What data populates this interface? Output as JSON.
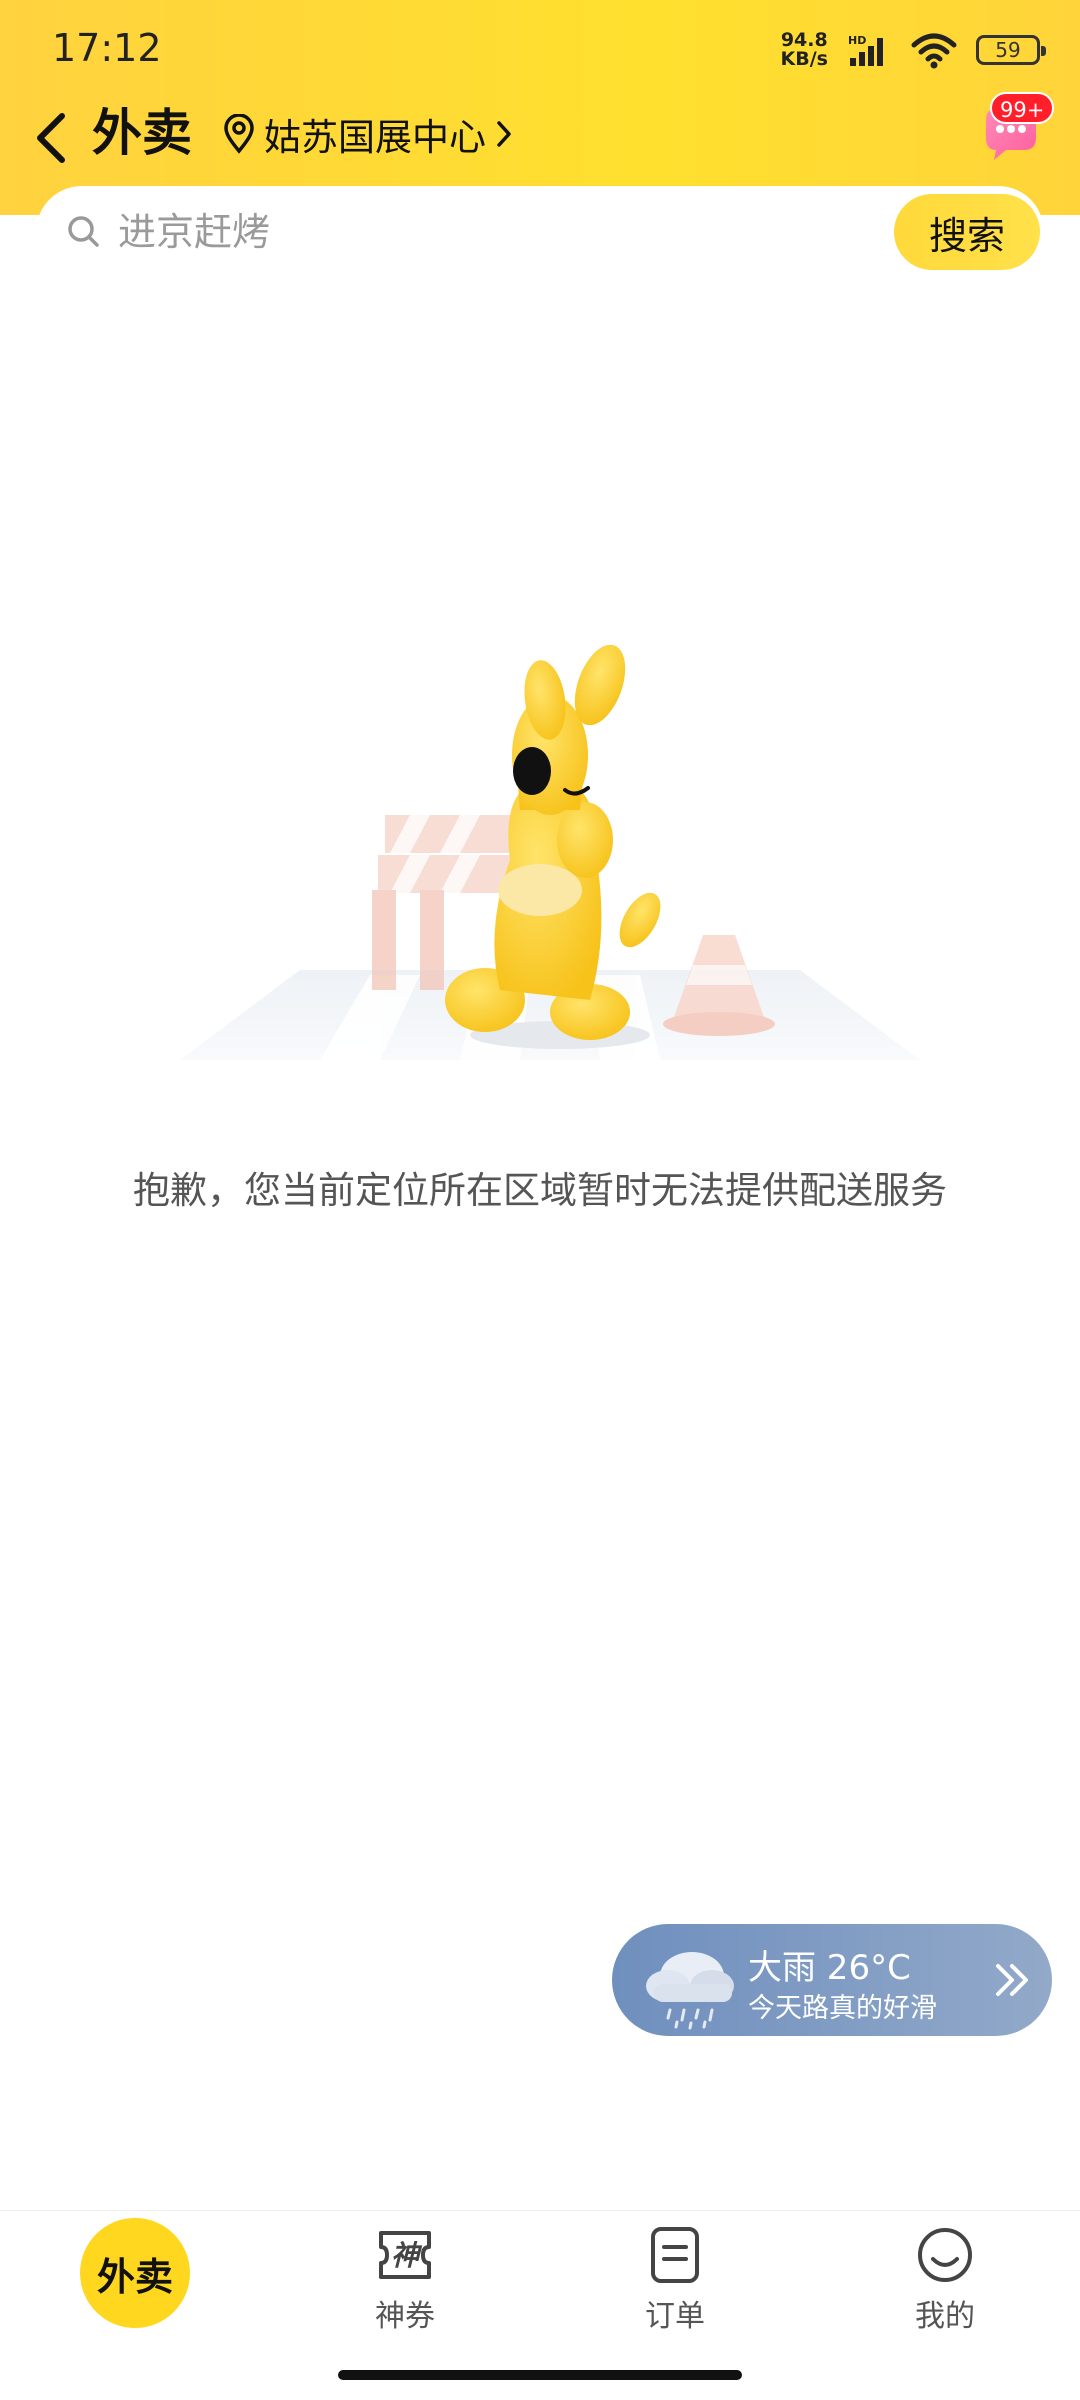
{
  "status_bar": {
    "time": "17:12",
    "net_speed": "94.8",
    "net_unit": "KB/s",
    "hd": "HD",
    "battery": "59"
  },
  "header": {
    "title": "外卖",
    "location": "姑苏国展中心",
    "badge": "99+"
  },
  "search": {
    "placeholder": "进京赶烤",
    "button_label": "搜索"
  },
  "main": {
    "empty_message": "抱歉，您当前定位所在区域暂时无法提供配送服务"
  },
  "weather": {
    "title": "大雨 26°C",
    "subtitle": "今天路真的好滑"
  },
  "tabbar": {
    "home_label": "外卖",
    "coupon_label": "神券",
    "coupon_icon_text": "神",
    "orders_label": "订单",
    "mine_label": "我的"
  },
  "colors": {
    "brand_yellow": "#ffd71f",
    "badge_red": "#ff1e2a",
    "weather_bg": "#7f9bc4"
  }
}
